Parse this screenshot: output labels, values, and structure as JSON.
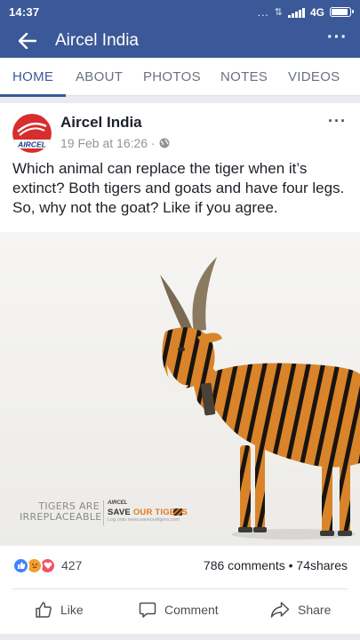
{
  "status_bar": {
    "time": "14:37",
    "dots": "...",
    "network": "4G",
    "battery_level": 0.95
  },
  "app_bar": {
    "title": "Aircel India",
    "menu": "···"
  },
  "tabs": [
    {
      "label": "HOME",
      "active": true
    },
    {
      "label": "ABOUT",
      "active": false
    },
    {
      "label": "PHOTOS",
      "active": false
    },
    {
      "label": "NOTES",
      "active": false
    },
    {
      "label": "VIDEOS",
      "active": false
    }
  ],
  "post": {
    "page_name": "Aircel India",
    "logo_text": "AIRCEL",
    "date": "19 Feb at 16:26 ·",
    "menu": "···",
    "text": "Which animal can replace the tiger when it’s extinct? Both tigers and goats and have four legs. So, why not the goat? Like if you agree.",
    "image": {
      "tagline_line1": "TIGERS ARE",
      "tagline_line2": "IRREPLACEABLE",
      "brand": "AIRCEL",
      "save_prefix": "SAVE",
      "save_accent": "OUR TIGERS",
      "small_text": "Log onto www.saveourtigers.com"
    },
    "reaction_count": "427",
    "comments_shares": "786 comments • 74shares",
    "actions": {
      "like": "Like",
      "comment": "Comment",
      "share": "Share"
    }
  },
  "colors": {
    "brand_blue": "#3b5998",
    "like_blue": "#4080ff",
    "love_red": "#f25268",
    "angry_orange": "#f0a030",
    "aircel_red": "#d62e2e"
  }
}
